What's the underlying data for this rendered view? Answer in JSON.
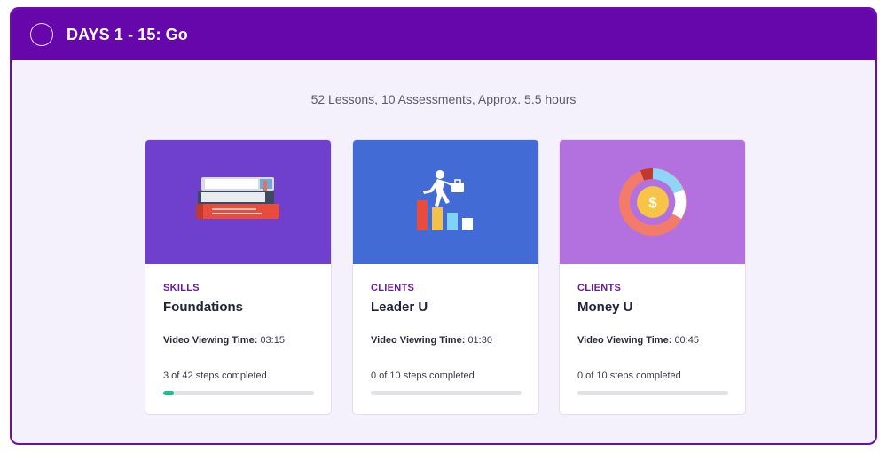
{
  "header": {
    "title": "DAYS 1 - 15: Go",
    "status_icon": "circle-outline-icon"
  },
  "summary": "52 Lessons, 10 Assessments, Approx. 5.5 hours",
  "courses": [
    {
      "category": "SKILLS",
      "name": "Foundations",
      "video_label": "Video Viewing Time:",
      "video_time": "03:15",
      "steps_text": "3 of 42 steps completed",
      "progress": 0.0714,
      "image_icon": "books-icon",
      "image_bg": "#6f40ce"
    },
    {
      "category": "CLIENTS",
      "name": "Leader U",
      "video_label": "Video Viewing Time:",
      "video_time": "01:30",
      "steps_text": "0 of 10 steps completed",
      "progress": 0,
      "image_icon": "climbing-bars-icon",
      "image_bg": "#436bd5"
    },
    {
      "category": "CLIENTS",
      "name": "Money U",
      "video_label": "Video Viewing Time:",
      "video_time": "00:45",
      "steps_text": "0 of 10 steps completed",
      "progress": 0,
      "image_icon": "dollar-donut-icon",
      "image_bg": "#b371e0"
    }
  ],
  "colors": {
    "header": "#6507ab",
    "progress_fill": "#19c38a",
    "progress_track": "#e2e2e6",
    "accent_text": "#6a1b9a"
  }
}
